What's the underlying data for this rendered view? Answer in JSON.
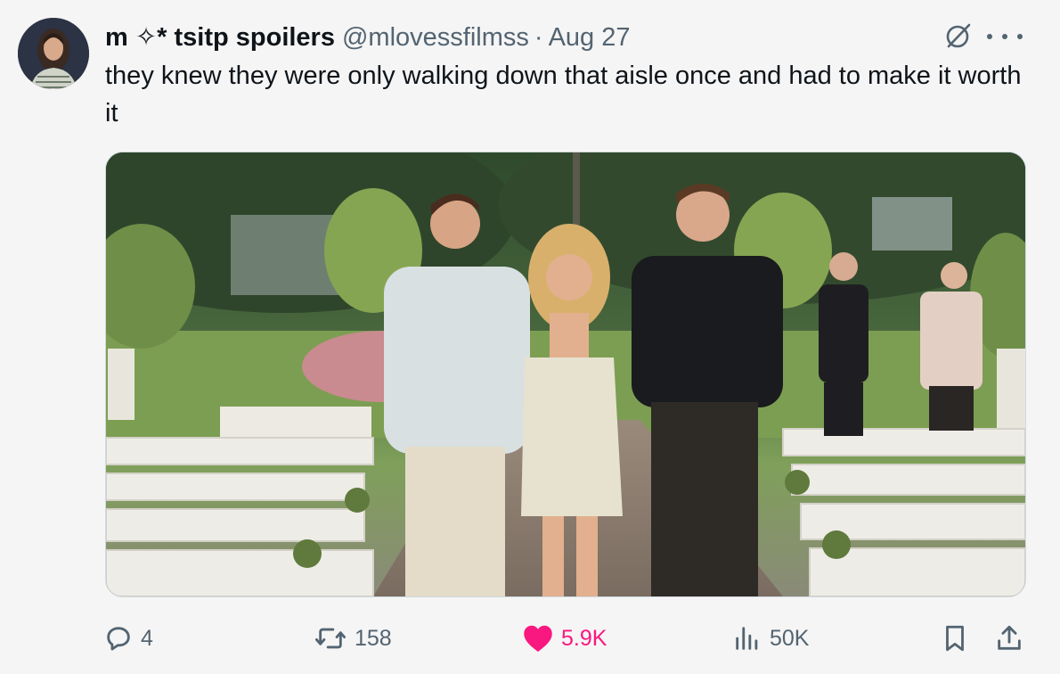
{
  "tweet": {
    "display_name": "m ✧* tsitp spoilers",
    "handle": "@mlovessfilmss",
    "separator": "·",
    "date": "Aug 27",
    "text": "they knew they were only walking down that aisle once and had to make it worth it",
    "media_description_icon": "photo"
  },
  "actions": {
    "replies": "4",
    "reposts": "158",
    "likes": "5.9K",
    "views": "50K"
  },
  "icons": {
    "reply": "reply-icon",
    "repost": "repost-icon",
    "like": "heart-icon",
    "views": "views-icon",
    "bookmark": "bookmark-icon",
    "share": "share-icon",
    "grok": "grok-icon",
    "more": "more-icon"
  },
  "colors": {
    "like_accent": "#f91880",
    "muted_text": "#536471",
    "primary_text": "#0f1419",
    "background": "#f5f5f5"
  }
}
